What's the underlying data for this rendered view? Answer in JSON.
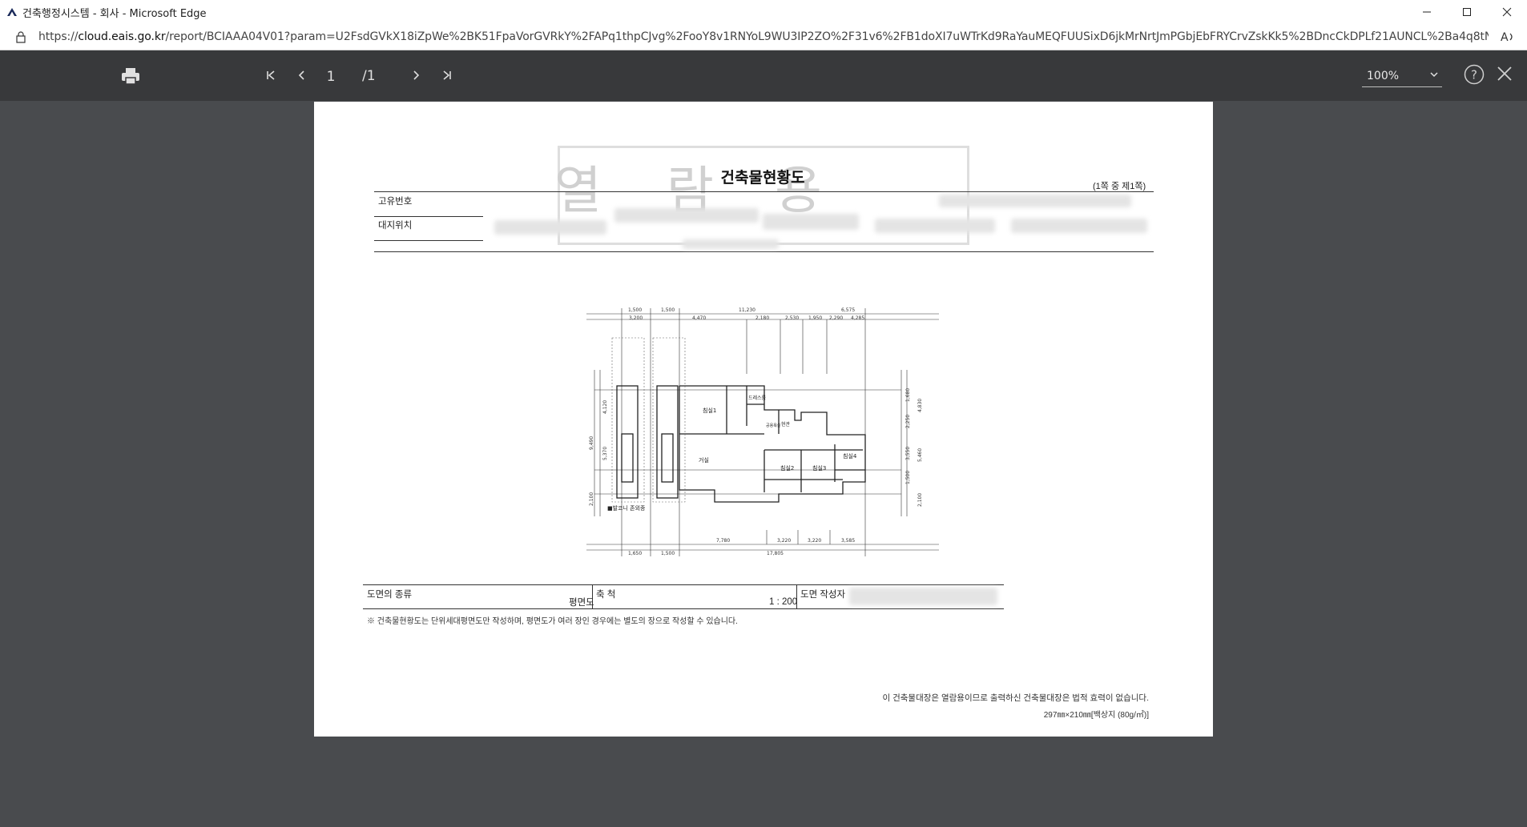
{
  "window": {
    "title": "건축행정시스템 - 회사 - Microsoft Edge",
    "minimize": "—",
    "maximize": "☐",
    "close": "✕"
  },
  "address": {
    "url_prefix": "https://",
    "url_host": "cloud.eais.go.kr",
    "url_rest": "/report/BCIAAA04V01?param=U2FsdGVkX18iZpWe%2BK51FpaVorGVRkY%2FAPq1thpCJvg%2FooY8v1RNYoL9WU3IP2ZO%2F31v6%2FB1doXI7uWTrKd9RaYauMEQFUUSixD6jkMrNrtJmPGbjEbFRYCrvZskKk5%2BDncCkDPLf21AUNCL%2Ba4q8tN2OBQHbMkrrF%2FT6FmjnUa..."
  },
  "viewer": {
    "page_current": "1",
    "page_total": "/1",
    "zoom": "100%",
    "icons": {
      "print": "print-icon",
      "first": "first-page-icon",
      "prev": "prev-page-icon",
      "next": "next-page-icon",
      "last": "last-page-icon",
      "help": "help-icon",
      "close": "close-icon"
    }
  },
  "document": {
    "title": "건축물현황도",
    "page_of": "(1쪽 중 제1쪽)",
    "label_unique_no": "고유번호",
    "label_site_location": "대지위치",
    "label_drawing_type": "도면의 종류",
    "drawing_type_value": "평면도",
    "label_scale": "축 척",
    "scale_value": "1 : 200",
    "label_drawing_author": "도면 작성자",
    "note": "※ 건축물현황도는 단위세대평면도만 작성하며, 평면도가 여러 장인 경우에는 별도의 장으로 작성할 수 있습니다.",
    "footer_notice": "이 건축물대장은 열람용이므로 출력하신 건축물대장은 법적 효력이 없습니다.",
    "footer_paper": "297㎜×210㎜[백상지 (80g/㎡)]",
    "watermark": [
      "열",
      "람",
      "용"
    ]
  },
  "plan_labels": {
    "room1": "침실1",
    "living": "거실",
    "room2": "침실2",
    "room3": "침실3",
    "room4": "침실4",
    "dress": "드레스룸",
    "entry": "현관",
    "bath": "공용욕실",
    "balcony": "■발코니 존외종",
    "dim_top": [
      "1,500",
      "1,500",
      "11,230",
      "6,575"
    ],
    "dim_top2": [
      "3,200",
      "4,470",
      "2,180",
      "2,530",
      "1,950",
      "2,290",
      "4,285"
    ],
    "dim_bottom": [
      "7,780",
      "3,220",
      "3,220",
      "3,585"
    ],
    "dim_bottom2": [
      "1,650",
      "1,500",
      "17,805"
    ],
    "dim_left": [
      "9,490",
      "4,120",
      "5,370",
      "2,100"
    ],
    "dim_right": [
      "1,680",
      "4,830",
      "2,250",
      "3,550",
      "5,460",
      "1,500",
      "2,100"
    ]
  }
}
